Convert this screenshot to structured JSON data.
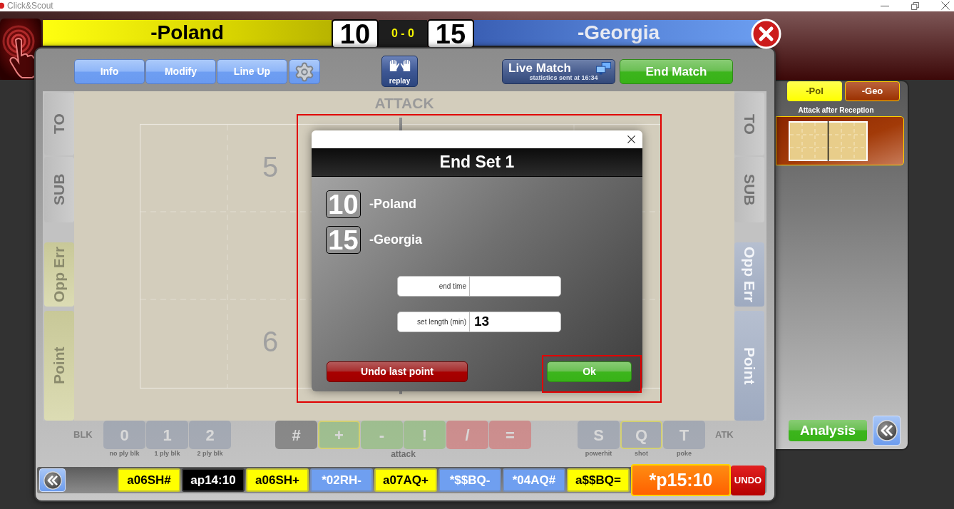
{
  "window": {
    "title": "Click&Scout"
  },
  "scoreboard": {
    "home": {
      "team": "-Poland",
      "score": "10"
    },
    "sets": "0 - 0",
    "away": {
      "team": "-Georgia",
      "score": "15"
    }
  },
  "toolbar": {
    "buttons": [
      {
        "label": "Info"
      },
      {
        "label": "Modify"
      },
      {
        "label": "Line Up"
      }
    ],
    "replay": {
      "label": "replay"
    },
    "live_match": {
      "label": "Live Match",
      "status": "statistics sent at 16:34"
    },
    "end_match": {
      "label": "End Match"
    }
  },
  "court": {
    "title": "ATTACK",
    "positions": [
      {
        "number": "5"
      },
      {
        "number": "6"
      }
    ],
    "left_buttons": [
      {
        "label": "TO",
        "kind": "plain"
      },
      {
        "label": "SUB",
        "kind": "plain"
      },
      {
        "label": "Opp Err",
        "kind": "team"
      },
      {
        "label": "Point",
        "kind": "team"
      }
    ],
    "right_buttons": [
      {
        "label": "TO",
        "kind": "plain"
      },
      {
        "label": "SUB",
        "kind": "plain"
      },
      {
        "label": "Opp Err",
        "kind": "team"
      },
      {
        "label": "Point",
        "kind": "team"
      }
    ]
  },
  "dialog": {
    "highlighted": true,
    "title": "End Set 1",
    "scores": [
      {
        "score": "10",
        "team": "-Poland"
      },
      {
        "score": "15",
        "team": "-Georgia"
      }
    ],
    "fields": [
      {
        "label": "end time"
      },
      {
        "label": "set length (min)",
        "value": "13"
      }
    ],
    "undo_button": {
      "label": "Undo last point"
    },
    "ok_button": {
      "label": "Ok",
      "highlighted": true
    }
  },
  "action_bar": {
    "disabled": true,
    "block": {
      "label": "BLK",
      "buttons": [
        {
          "label": "0",
          "caption": "no ply blk",
          "selected": false
        },
        {
          "label": "1",
          "caption": "1 ply blk",
          "selected": false
        },
        {
          "label": "2",
          "caption": "2 ply blk",
          "selected": false
        }
      ]
    },
    "evaluation": {
      "caption": "attack",
      "buttons": [
        {
          "label": "#",
          "kind": "dark",
          "selected": false
        },
        {
          "label": "+",
          "kind": "green",
          "selected": true
        },
        {
          "label": "-",
          "kind": "green",
          "selected": false
        },
        {
          "label": "!",
          "kind": "green",
          "selected": false
        },
        {
          "label": "/",
          "kind": "red",
          "selected": false
        },
        {
          "label": "=",
          "kind": "red",
          "selected": false
        }
      ]
    },
    "attack_type": {
      "label": "ATK",
      "buttons": [
        {
          "label": "S",
          "caption": "powerhit",
          "selected": false
        },
        {
          "label": "Q",
          "caption": "shot",
          "selected": true
        },
        {
          "label": "T",
          "caption": "poke",
          "selected": false
        }
      ]
    }
  },
  "code_strip": {
    "codes": [
      {
        "text": "a06SH#",
        "color": "#ffff00"
      },
      {
        "text": "ap14:10",
        "color": "#000000"
      },
      {
        "text": "a06SH+",
        "color": "#ffff00"
      },
      {
        "text": "*02RH-",
        "color": "#6f9ff0"
      },
      {
        "text": "a07AQ+",
        "color": "#ffff00"
      },
      {
        "text": "*$$BQ-",
        "color": "#6f9ff0"
      },
      {
        "text": "*04AQ#",
        "color": "#6f9ff0"
      },
      {
        "text": "a$$BQ=",
        "color": "#ffff00"
      }
    ],
    "current": {
      "text": "*p15:10"
    },
    "undo": {
      "label": "UNDO"
    }
  },
  "analysis_panel": {
    "tabs": [
      {
        "label": "-Pol",
        "selected": true
      },
      {
        "label": "-Geo",
        "selected": false
      }
    ],
    "section_title": "Attack after Reception",
    "analysis_button": {
      "label": "Analysis"
    }
  }
}
